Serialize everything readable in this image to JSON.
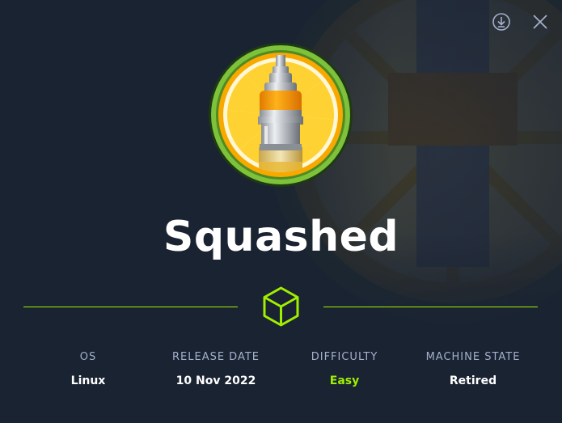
{
  "machine": {
    "name": "Squashed"
  },
  "info": [
    {
      "label": "OS",
      "value": "Linux"
    },
    {
      "label": "RELEASE DATE",
      "value": "10 Nov 2022"
    },
    {
      "label": "DIFFICULTY",
      "value": "Easy"
    },
    {
      "label": "MACHINE STATE",
      "value": "Retired"
    }
  ],
  "icons": {
    "download": "download-icon",
    "close": "close-icon",
    "divider": "cube-icon",
    "logo": "squashed-logo"
  },
  "colors": {
    "background": "#1a2332",
    "accent": "#9fef00",
    "label": "#a4b1cd",
    "easy": "#9fef00"
  }
}
